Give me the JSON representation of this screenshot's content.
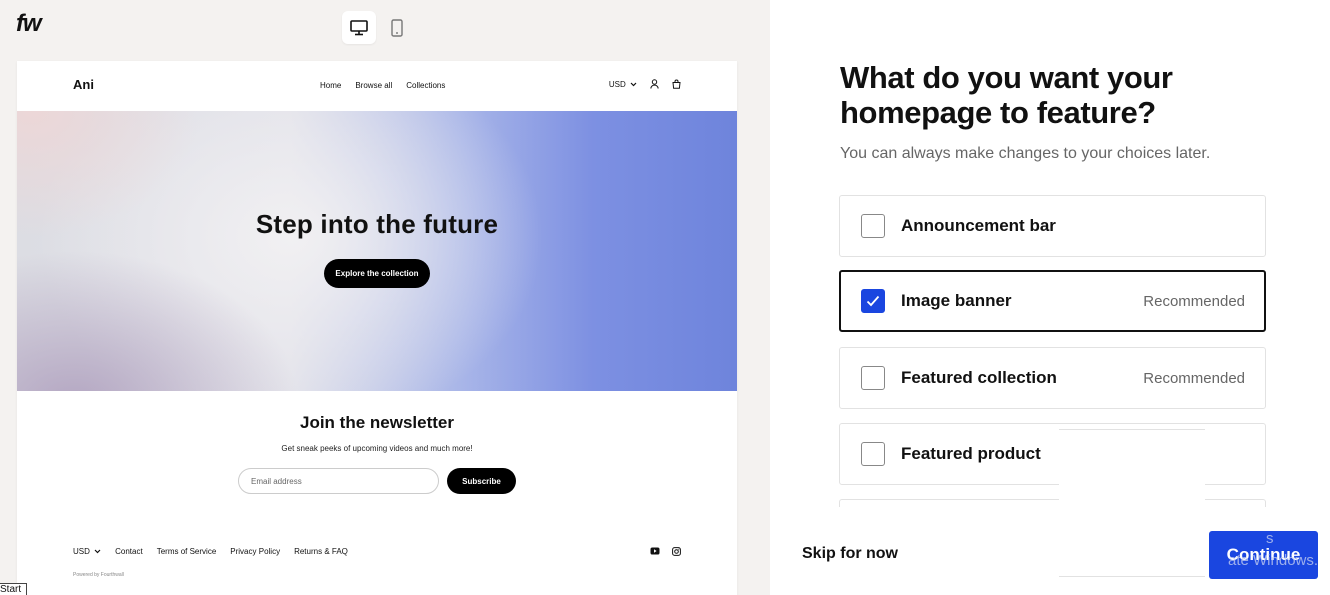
{
  "app": {
    "logo": "fw"
  },
  "device_toggle": {
    "desktop_icon": "desktop-monitor-icon",
    "mobile_icon": "mobile-phone-icon"
  },
  "preview": {
    "store_name": "Ani",
    "nav": [
      "Home",
      "Browse all",
      "Collections"
    ],
    "currency": "USD",
    "hero": {
      "title": "Step into the future",
      "button": "Explore the collection"
    },
    "newsletter": {
      "title": "Join the newsletter",
      "subtitle": "Get sneak peeks of upcoming videos and much more!",
      "email_placeholder": "Email address",
      "subscribe": "Subscribe"
    },
    "footer": {
      "currency": "USD",
      "links": [
        "Contact",
        "Terms of Service",
        "Privacy Policy",
        "Returns & FAQ"
      ],
      "powered_by": "Powered by Fourthwall"
    }
  },
  "start_label": "Start",
  "onboarding": {
    "title": "What do you want your homepage to feature?",
    "subtitle": "You can always make changes to your choices later.",
    "options": [
      {
        "label": "Announcement bar",
        "recommended": "",
        "checked": false
      },
      {
        "label": "Image banner",
        "recommended": "Recommended",
        "checked": true
      },
      {
        "label": "Featured collection",
        "recommended": "Recommended",
        "checked": false
      },
      {
        "label": "Featured product",
        "recommended": "",
        "checked": false
      }
    ],
    "skip": "Skip for now",
    "continue": "Continue",
    "watermark": [
      "s",
      "ate Windows."
    ]
  },
  "colors": {
    "accent": "#1a46e0",
    "left_bg": "#f4f2f0"
  }
}
